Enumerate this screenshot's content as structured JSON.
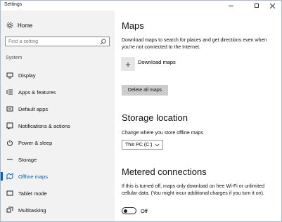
{
  "window": {
    "title": "Settings"
  },
  "sidebar": {
    "home_label": "Home",
    "search_placeholder": "Find a setting",
    "section_label": "System",
    "items": [
      {
        "label": "Display",
        "icon": "monitor-icon"
      },
      {
        "label": "Apps & features",
        "icon": "apps-list-icon"
      },
      {
        "label": "Default apps",
        "icon": "default-apps-icon"
      },
      {
        "label": "Notifications & actions",
        "icon": "notification-icon"
      },
      {
        "label": "Power & sleep",
        "icon": "power-icon"
      },
      {
        "label": "Storage",
        "icon": "storage-icon"
      },
      {
        "label": "Offline maps",
        "icon": "map-icon",
        "active": true
      },
      {
        "label": "Tablet mode",
        "icon": "tablet-icon"
      },
      {
        "label": "Multitasking",
        "icon": "multitasking-icon"
      }
    ]
  },
  "main": {
    "maps": {
      "heading": "Maps",
      "description": "Download maps to search for places and get directions even when you're not connected to the Internet.",
      "download_label": "Download maps",
      "delete_button": "Delete all maps"
    },
    "storage": {
      "heading": "Storage location",
      "description": "Change where you store offline maps",
      "selected": "This PC (C:)"
    },
    "metered": {
      "heading": "Metered connections",
      "description": "If this is turned off, maps only download on free Wi-Fi or unlimited cellular data. (You might incur additional charges if you turn it on).",
      "toggle_state": "Off"
    }
  },
  "colors": {
    "accent": "#0063b1",
    "sidebar_bg": "#f2f2f2",
    "button_bg": "#cccccc"
  }
}
